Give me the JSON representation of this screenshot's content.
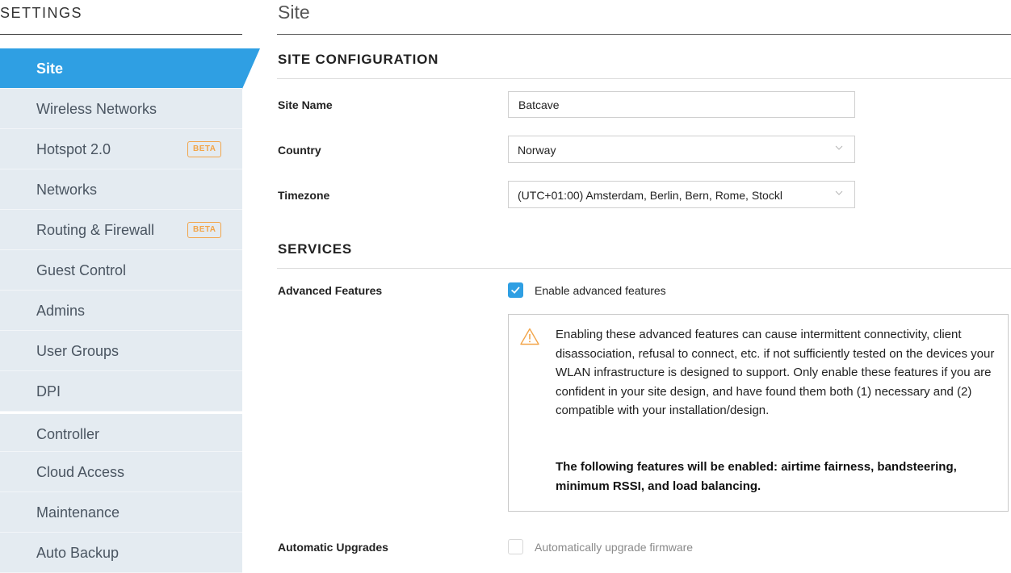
{
  "sidebar": {
    "title": "SETTINGS",
    "items": [
      {
        "label": "Site"
      },
      {
        "label": "Wireless Networks"
      },
      {
        "label": "Hotspot 2.0",
        "badge": "BETA"
      },
      {
        "label": "Networks"
      },
      {
        "label": "Routing & Firewall",
        "badge": "BETA"
      },
      {
        "label": "Guest Control"
      },
      {
        "label": "Admins"
      },
      {
        "label": "User Groups"
      },
      {
        "label": "DPI"
      },
      {
        "label": "Controller"
      },
      {
        "label": "Cloud Access"
      },
      {
        "label": "Maintenance"
      },
      {
        "label": "Auto Backup"
      }
    ]
  },
  "main": {
    "title": "Site",
    "site_configuration": {
      "heading": "SITE CONFIGURATION",
      "site_name_label": "Site Name",
      "site_name_value": "Batcave",
      "country_label": "Country",
      "country_value": "Norway",
      "timezone_label": "Timezone",
      "timezone_value": "(UTC+01:00) Amsterdam, Berlin, Bern, Rome, Stockl"
    },
    "services": {
      "heading": "SERVICES",
      "advanced_label": "Advanced Features",
      "advanced_checkbox_label": "Enable advanced features",
      "advanced_checked": true,
      "warning_text": "Enabling these advanced features can cause intermittent connectivity, client disassociation, refusal to connect, etc. if not sufficiently tested on the devices your WLAN infrastructure is designed to support. Only enable these features if you are confident in your site design, and have found them both (1) necessary and (2) compatible with your installation/design.",
      "warning_strong": "The following features will be enabled: airtime fairness, bandsteering, minimum RSSI, and load balancing.",
      "upgrades_label": "Automatic Upgrades",
      "upgrades_checkbox_label": "Automatically upgrade firmware",
      "upgrades_checked": false
    }
  },
  "colors": {
    "accent": "#2f9fe3",
    "beta": "#f2a54a",
    "nav_bg": "#e4ebf1"
  }
}
